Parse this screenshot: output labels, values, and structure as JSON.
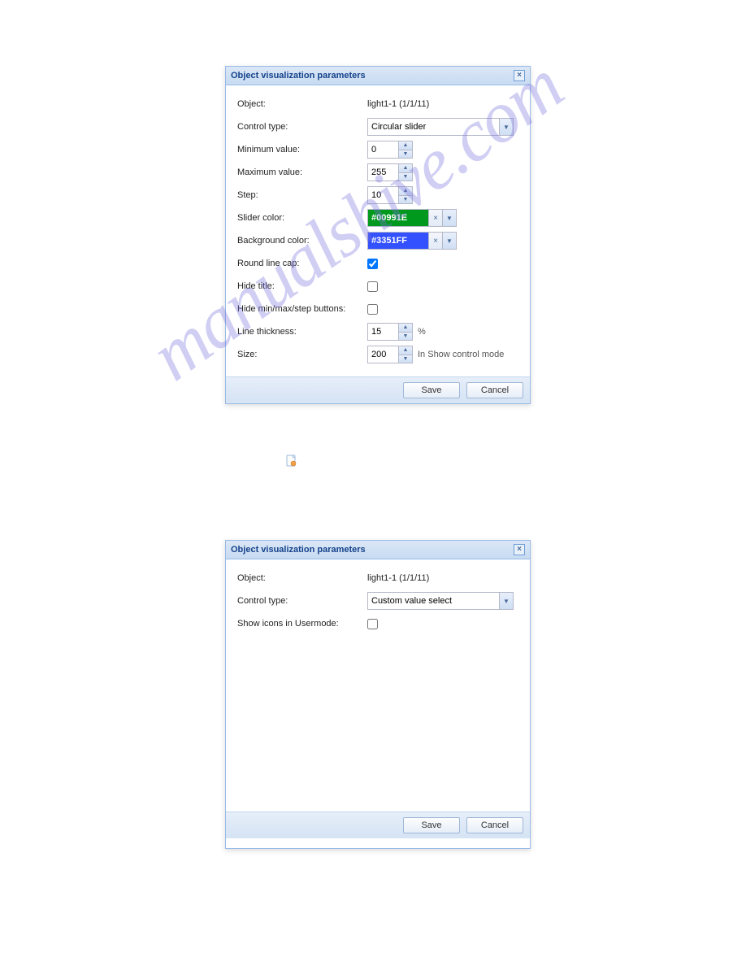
{
  "watermark": "manualshive.com",
  "dialog1": {
    "title": "Object visualization parameters",
    "object_label": "Object:",
    "object_value": "light1-1 (1/1/11)",
    "control_type_label": "Control type:",
    "control_type_value": "Circular slider",
    "min_label": "Minimum value:",
    "min_value": "0",
    "max_label": "Maximum value:",
    "max_value": "255",
    "step_label": "Step:",
    "step_value": "10",
    "slider_color_label": "Slider color:",
    "slider_color_value": "#00991E",
    "slider_color_hex": "#00991E",
    "bg_color_label": "Background color:",
    "bg_color_value": "#3351FF",
    "bg_color_hex": "#3351FF",
    "round_cap_label": "Round line cap:",
    "round_cap_checked": true,
    "hide_title_label": "Hide title:",
    "hide_title_checked": false,
    "hide_buttons_label": "Hide min/max/step buttons:",
    "hide_buttons_checked": false,
    "line_thickness_label": "Line thickness:",
    "line_thickness_value": "15",
    "line_thickness_suffix": "%",
    "size_label": "Size:",
    "size_value": "200",
    "size_suffix": "In Show control mode",
    "save": "Save",
    "cancel": "Cancel"
  },
  "dialog2": {
    "title": "Object visualization parameters",
    "object_label": "Object:",
    "object_value": "light1-1 (1/1/11)",
    "control_type_label": "Control type:",
    "control_type_value": "Custom value select",
    "show_icons_label": "Show icons in Usermode:",
    "show_icons_checked": false,
    "save": "Save",
    "cancel": "Cancel"
  }
}
